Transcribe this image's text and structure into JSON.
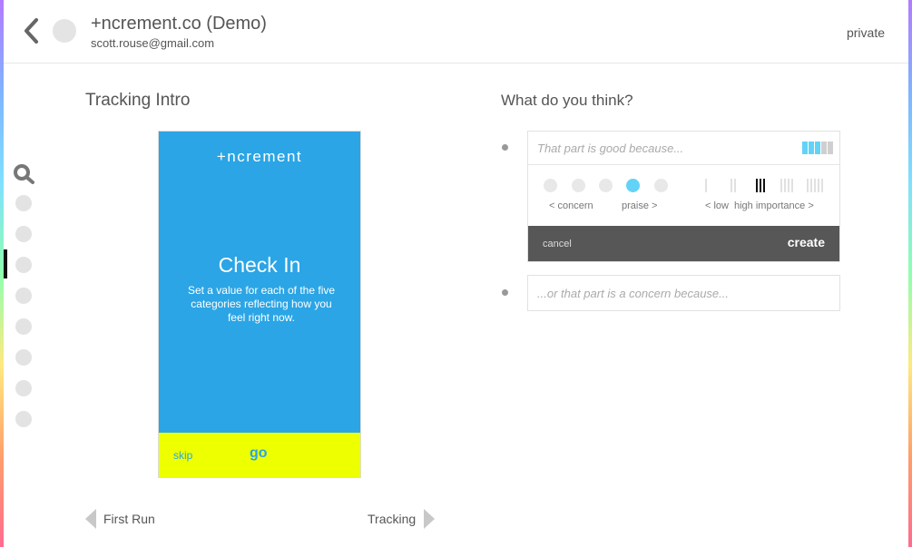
{
  "header": {
    "org_name": "+ncrement.co (Demo)",
    "user_email": "scott.rouse@gmail.com",
    "privacy": "private",
    "back_icon": "chevron-left-icon"
  },
  "side_nav": {
    "search_icon": "search-icon",
    "dot_count": 8,
    "active_index": 2
  },
  "left_panel": {
    "title": "Tracking Intro",
    "phone": {
      "brand": "+ncrement",
      "heading": "Check In",
      "body": "Set a value for each of the five categories reflecting how you feel right now.",
      "skip": "skip",
      "go": "go",
      "background": "#2ba5e5",
      "footer_color": "#eeff00"
    },
    "prev_label": "First Run",
    "next_label": "Tracking"
  },
  "right_panel": {
    "title": "What do you think?",
    "praise_placeholder": "That part is good because...",
    "concern_label": "< concern",
    "praise_label": "praise >",
    "low_label": "< low",
    "high_label": "high importance >",
    "sentiment_selected": 4,
    "importance_selected": 3,
    "cancel": "cancel",
    "create": "create",
    "concern_placeholder": "...or that part is a concern because...",
    "accent_color": "#62d3f6"
  }
}
